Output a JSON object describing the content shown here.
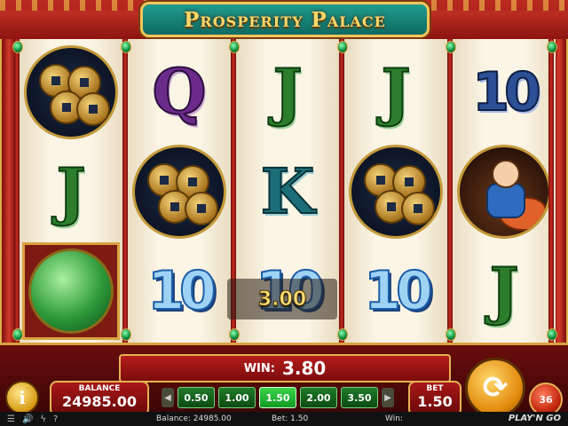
{
  "game": {
    "title": "Prosperity Palace"
  },
  "reels": [
    [
      {
        "kind": "coins",
        "name": "coins"
      },
      {
        "kind": "letter",
        "text": "J",
        "color": "green"
      },
      {
        "kind": "dragon",
        "name": "jade-dragon"
      }
    ],
    [
      {
        "kind": "letter",
        "text": "Q",
        "color": "purple"
      },
      {
        "kind": "coins",
        "name": "coins"
      },
      {
        "kind": "ten",
        "text": "10",
        "color": "ice"
      }
    ],
    [
      {
        "kind": "letter",
        "text": "J",
        "color": "green"
      },
      {
        "kind": "letter",
        "text": "K",
        "color": "teal"
      },
      {
        "kind": "ten",
        "text": "10",
        "color": "ice"
      }
    ],
    [
      {
        "kind": "letter",
        "text": "J",
        "color": "green"
      },
      {
        "kind": "coins",
        "name": "coins"
      },
      {
        "kind": "ten",
        "text": "10",
        "color": "ice"
      }
    ],
    [
      {
        "kind": "ten",
        "text": "10",
        "color": "blue"
      },
      {
        "kind": "boy",
        "name": "boy-fish"
      },
      {
        "kind": "letter",
        "text": "J",
        "color": "green"
      }
    ]
  ],
  "popup": {
    "value": "3.00"
  },
  "win_bar": {
    "label": "WIN:",
    "value": "3.80"
  },
  "balance": {
    "label": "BALANCE",
    "value": "24985.00"
  },
  "bet_options": [
    "0.50",
    "1.00",
    "1.50",
    "2.00",
    "3.50"
  ],
  "bet_selected": "1.50",
  "bet": {
    "label": "BET",
    "value": "1.50"
  },
  "buttons": {
    "info": "i",
    "autoplay": "36"
  },
  "status": {
    "balance": "Balance: 24985.00",
    "bet": "Bet: 1.50",
    "win": "Win:",
    "logo": "PLAY'N GO"
  }
}
